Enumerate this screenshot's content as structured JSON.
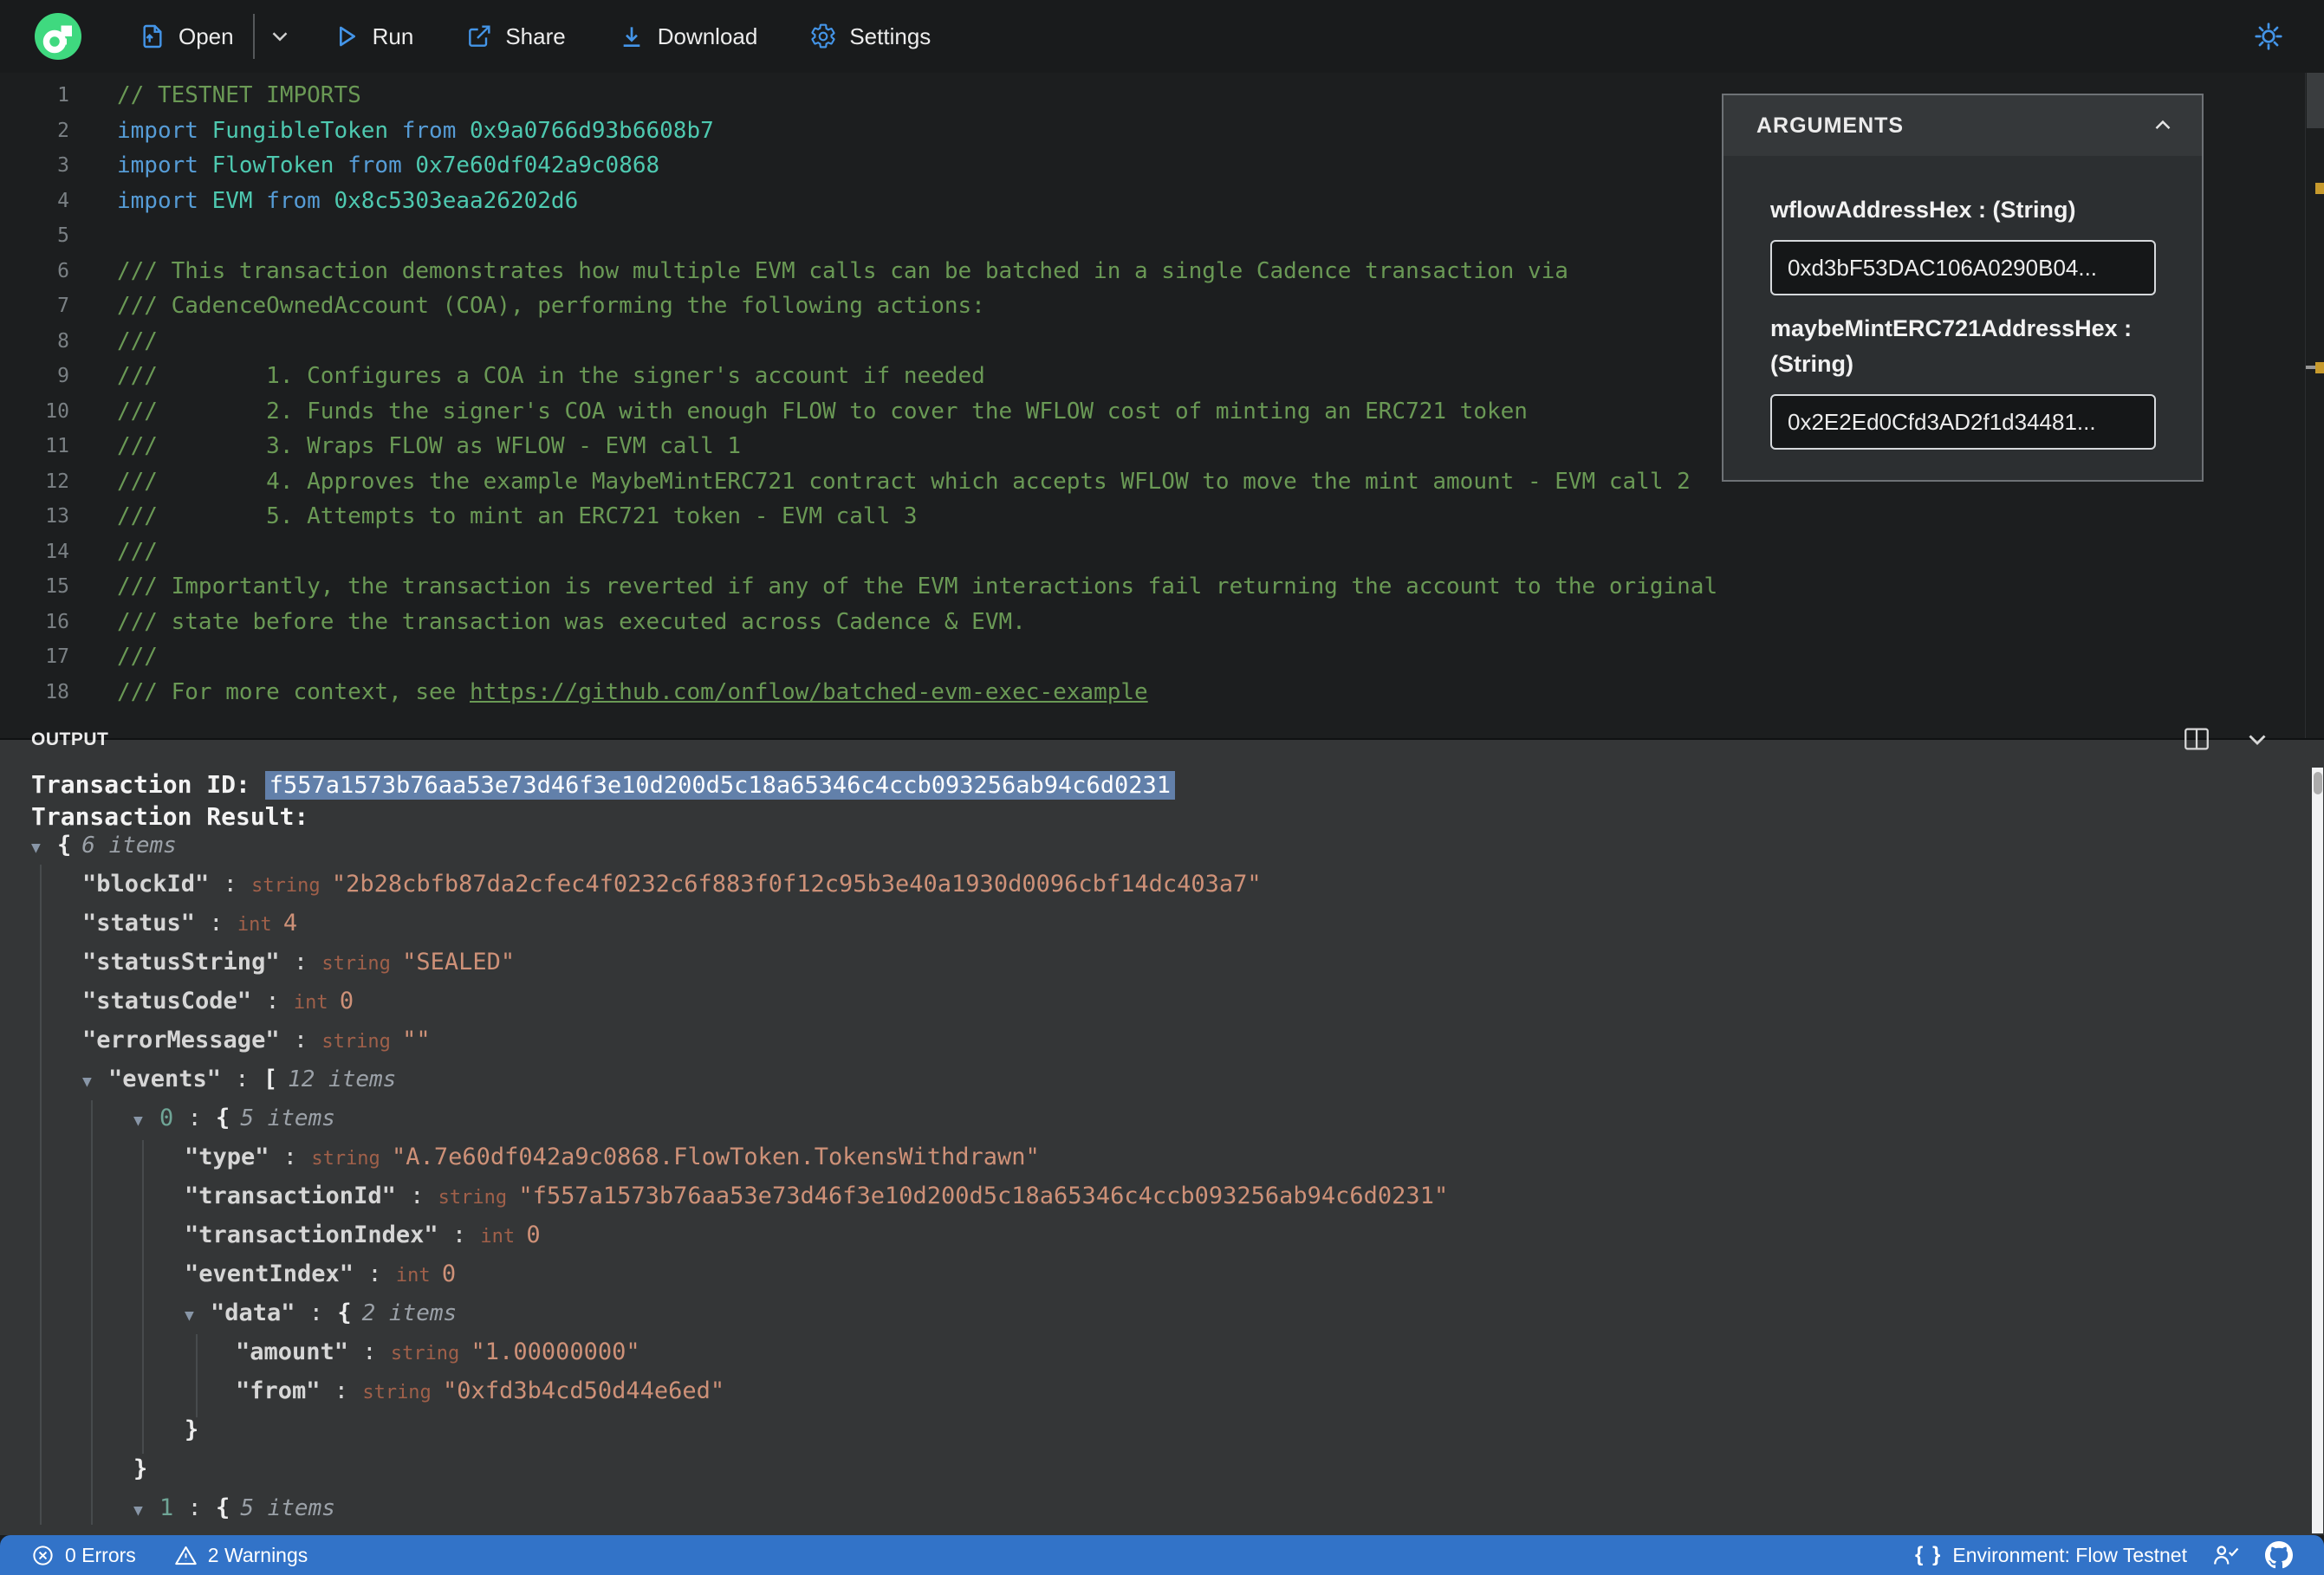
{
  "toolbar": {
    "open_label": "Open",
    "run_label": "Run",
    "share_label": "Share",
    "download_label": "Download",
    "settings_label": "Settings"
  },
  "editor": {
    "lines": [
      {
        "num": 1,
        "tokens": [
          {
            "c": "c",
            "t": "// TESTNET IMPORTS"
          }
        ]
      },
      {
        "num": 2,
        "tokens": [
          {
            "c": "k",
            "t": "import "
          },
          {
            "c": "t",
            "t": "FungibleToken"
          },
          {
            "c": "k",
            "t": " from "
          },
          {
            "c": "t",
            "t": "0x9a0766d93b6608b7"
          }
        ]
      },
      {
        "num": 3,
        "tokens": [
          {
            "c": "k",
            "t": "import "
          },
          {
            "c": "t",
            "t": "FlowToken"
          },
          {
            "c": "k",
            "t": " from "
          },
          {
            "c": "t",
            "t": "0x7e60df042a9c0868"
          }
        ]
      },
      {
        "num": 4,
        "tokens": [
          {
            "c": "k",
            "t": "import "
          },
          {
            "c": "t",
            "t": "EVM"
          },
          {
            "c": "k",
            "t": " from "
          },
          {
            "c": "t",
            "t": "0x8c5303eaa26202d6"
          }
        ]
      },
      {
        "num": 5,
        "tokens": []
      },
      {
        "num": 6,
        "tokens": [
          {
            "c": "c",
            "t": "/// This transaction demonstrates how multiple EVM calls can be batched in a single Cadence transaction via"
          }
        ]
      },
      {
        "num": 7,
        "tokens": [
          {
            "c": "c",
            "t": "/// CadenceOwnedAccount (COA), performing the following actions:"
          }
        ]
      },
      {
        "num": 8,
        "tokens": [
          {
            "c": "c",
            "t": "///"
          }
        ]
      },
      {
        "num": 9,
        "tokens": [
          {
            "c": "c",
            "t": "///        1. Configures a COA in the signer's account if needed"
          }
        ]
      },
      {
        "num": 10,
        "tokens": [
          {
            "c": "c",
            "t": "///        2. Funds the signer's COA with enough FLOW to cover the WFLOW cost of minting an ERC721 token"
          }
        ]
      },
      {
        "num": 11,
        "tokens": [
          {
            "c": "c",
            "t": "///        3. Wraps FLOW as WFLOW - EVM call 1"
          }
        ]
      },
      {
        "num": 12,
        "tokens": [
          {
            "c": "c",
            "t": "///        4. Approves the example MaybeMintERC721 contract which accepts WFLOW to move the mint amount - EVM call 2"
          }
        ]
      },
      {
        "num": 13,
        "tokens": [
          {
            "c": "c",
            "t": "///        5. Attempts to mint an ERC721 token - EVM call 3"
          }
        ]
      },
      {
        "num": 14,
        "tokens": [
          {
            "c": "c",
            "t": "///"
          }
        ]
      },
      {
        "num": 15,
        "tokens": [
          {
            "c": "c",
            "t": "/// Importantly, the transaction is reverted if any of the EVM interactions fail returning the account to the original"
          }
        ]
      },
      {
        "num": 16,
        "tokens": [
          {
            "c": "c",
            "t": "/// state before the transaction was executed across Cadence & EVM."
          }
        ]
      },
      {
        "num": 17,
        "tokens": [
          {
            "c": "c",
            "t": "///"
          }
        ]
      },
      {
        "num": 18,
        "tokens": [
          {
            "c": "c",
            "t": "/// For more context, see "
          },
          {
            "c": "l",
            "t": "https://github.com/onflow/batched-evm-exec-example"
          }
        ]
      }
    ]
  },
  "arguments_panel": {
    "title": "ARGUMENTS",
    "args": [
      {
        "label": "wflowAddressHex : (String)",
        "value": "0xd3bF53DAC106A0290B04..."
      },
      {
        "label": "maybeMintERC721AddressHex : (String)",
        "value": "0x2E2Ed0Cfd3AD2f1d34481..."
      }
    ]
  },
  "output": {
    "title": "OUTPUT",
    "transaction_id_label": "Transaction ID: ",
    "transaction_id": "f557a1573b76aa53e73d46f3e10d200d5c18a65346c4ccb093256ab94c6d0231",
    "transaction_result_label": "Transaction Result:",
    "tree": [
      {
        "depth": 0,
        "arrow": true,
        "parts": [
          {
            "c": "br",
            "t": "{"
          },
          {
            "c": "it",
            "t": "6 items"
          }
        ]
      },
      {
        "depth": 1,
        "arrow": false,
        "parts": [
          {
            "c": "ky",
            "t": "\"blockId\""
          },
          {
            "c": "co",
            "t": " : "
          },
          {
            "c": "ty",
            "t": "string "
          },
          {
            "c": "va",
            "t": "\"2b28cbfb87da2cfec4f0232c6f883f0f12c95b3e40a1930d0096cbf14dc403a7\""
          }
        ]
      },
      {
        "depth": 1,
        "arrow": false,
        "parts": [
          {
            "c": "ky",
            "t": "\"status\""
          },
          {
            "c": "co",
            "t": " : "
          },
          {
            "c": "ty",
            "t": "int "
          },
          {
            "c": "va",
            "t": "4"
          }
        ]
      },
      {
        "depth": 1,
        "arrow": false,
        "parts": [
          {
            "c": "ky",
            "t": "\"statusString\""
          },
          {
            "c": "co",
            "t": " : "
          },
          {
            "c": "ty",
            "t": "string "
          },
          {
            "c": "va",
            "t": "\"SEALED\""
          }
        ]
      },
      {
        "depth": 1,
        "arrow": false,
        "parts": [
          {
            "c": "ky",
            "t": "\"statusCode\""
          },
          {
            "c": "co",
            "t": " : "
          },
          {
            "c": "ty",
            "t": "int "
          },
          {
            "c": "va",
            "t": "0"
          }
        ]
      },
      {
        "depth": 1,
        "arrow": false,
        "parts": [
          {
            "c": "ky",
            "t": "\"errorMessage\""
          },
          {
            "c": "co",
            "t": " : "
          },
          {
            "c": "ty",
            "t": "string "
          },
          {
            "c": "va",
            "t": "\"\""
          }
        ]
      },
      {
        "depth": 1,
        "arrow": true,
        "parts": [
          {
            "c": "ky",
            "t": "\"events\""
          },
          {
            "c": "co",
            "t": " : "
          },
          {
            "c": "br",
            "t": "["
          },
          {
            "c": "it",
            "t": "12 items"
          }
        ]
      },
      {
        "depth": 2,
        "arrow": true,
        "parts": [
          {
            "c": "ix",
            "t": "0"
          },
          {
            "c": "co",
            "t": " : "
          },
          {
            "c": "br",
            "t": "{"
          },
          {
            "c": "it",
            "t": "5 items"
          }
        ]
      },
      {
        "depth": 3,
        "arrow": false,
        "parts": [
          {
            "c": "ky",
            "t": "\"type\""
          },
          {
            "c": "co",
            "t": " : "
          },
          {
            "c": "ty",
            "t": "string "
          },
          {
            "c": "va",
            "t": "\"A.7e60df042a9c0868.FlowToken.TokensWithdrawn\""
          }
        ]
      },
      {
        "depth": 3,
        "arrow": false,
        "parts": [
          {
            "c": "ky",
            "t": "\"transactionId\""
          },
          {
            "c": "co",
            "t": " : "
          },
          {
            "c": "ty",
            "t": "string "
          },
          {
            "c": "va",
            "t": "\"f557a1573b76aa53e73d46f3e10d200d5c18a65346c4ccb093256ab94c6d0231\""
          }
        ]
      },
      {
        "depth": 3,
        "arrow": false,
        "parts": [
          {
            "c": "ky",
            "t": "\"transactionIndex\""
          },
          {
            "c": "co",
            "t": " : "
          },
          {
            "c": "ty",
            "t": "int "
          },
          {
            "c": "va",
            "t": "0"
          }
        ]
      },
      {
        "depth": 3,
        "arrow": false,
        "parts": [
          {
            "c": "ky",
            "t": "\"eventIndex\""
          },
          {
            "c": "co",
            "t": " : "
          },
          {
            "c": "ty",
            "t": "int "
          },
          {
            "c": "va",
            "t": "0"
          }
        ]
      },
      {
        "depth": 3,
        "arrow": true,
        "parts": [
          {
            "c": "ky",
            "t": "\"data\""
          },
          {
            "c": "co",
            "t": " : "
          },
          {
            "c": "br",
            "t": "{"
          },
          {
            "c": "it",
            "t": "2 items"
          }
        ]
      },
      {
        "depth": 4,
        "arrow": false,
        "parts": [
          {
            "c": "ky",
            "t": "\"amount\""
          },
          {
            "c": "co",
            "t": " : "
          },
          {
            "c": "ty",
            "t": "string "
          },
          {
            "c": "va",
            "t": "\"1.00000000\""
          }
        ]
      },
      {
        "depth": 4,
        "arrow": false,
        "parts": [
          {
            "c": "ky",
            "t": "\"from\""
          },
          {
            "c": "co",
            "t": " : "
          },
          {
            "c": "ty",
            "t": "string "
          },
          {
            "c": "va",
            "t": "\"0xfd3b4cd50d44e6ed\""
          }
        ]
      },
      {
        "depth": 3,
        "arrow": false,
        "parts": [
          {
            "c": "br",
            "t": "}"
          }
        ]
      },
      {
        "depth": 2,
        "arrow": false,
        "parts": [
          {
            "c": "br",
            "t": "}"
          }
        ]
      },
      {
        "depth": 2,
        "arrow": true,
        "parts": [
          {
            "c": "ix",
            "t": "1"
          },
          {
            "c": "co",
            "t": " : "
          },
          {
            "c": "br",
            "t": "{"
          },
          {
            "c": "it",
            "t": "5 items"
          }
        ]
      }
    ]
  },
  "statusbar": {
    "errors": "0 Errors",
    "warnings": "2 Warnings",
    "env_icon": "{ }",
    "environment": "Environment: Flow Testnet"
  },
  "colors": {
    "accent_blue": "#4495e8",
    "flow_green": "#3fd97f",
    "statusbar_blue": "#3273c8",
    "selection_blue": "#6280aa",
    "comment_green": "#6a9955",
    "keyword_blue": "#569cd6",
    "type_teal": "#4ec9b0",
    "string_orange": "#ce9178",
    "warning_yellow": "#c79a2d"
  }
}
